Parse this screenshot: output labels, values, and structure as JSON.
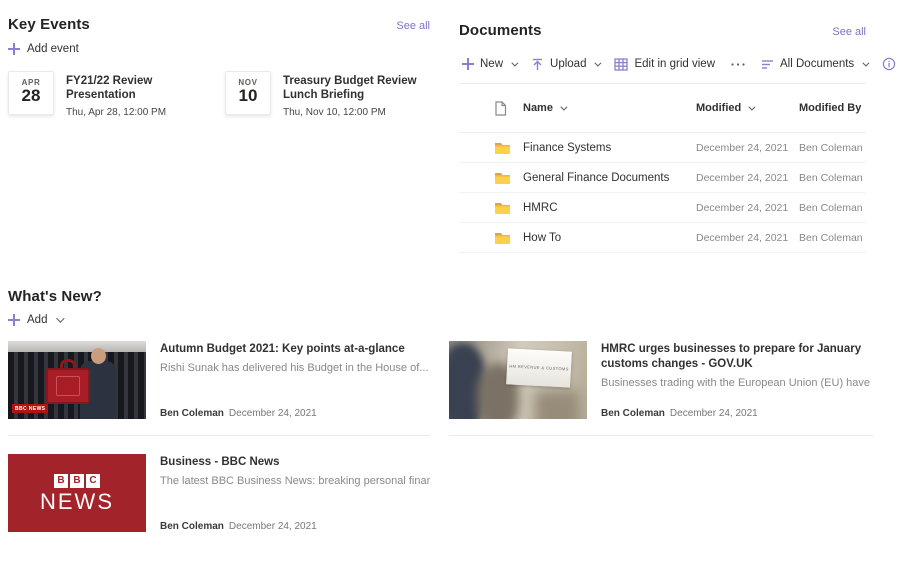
{
  "colors": {
    "accent": "#7b74c6",
    "icon_accent": "#8a7fd0",
    "folder_body": "#ffd04b",
    "folder_tab": "#e3a23e",
    "bbc_red": "#a3232b"
  },
  "key_events": {
    "title": "Key Events",
    "see_all": "See all",
    "add_label": "Add event",
    "events": [
      {
        "month": "APR",
        "day": "28",
        "title": "FY21/22 Review Presentation",
        "when": "Thu, Apr 28, 12:00 PM"
      },
      {
        "month": "NOV",
        "day": "10",
        "title": "Treasury Budget Review Lunch Briefing",
        "when": "Thu, Nov 10, 12:00 PM"
      }
    ]
  },
  "documents": {
    "title": "Documents",
    "see_all": "See all",
    "toolbar": {
      "new": "New",
      "upload": "Upload",
      "grid": "Edit in grid view",
      "view": "All Documents"
    },
    "columns": {
      "name": "Name",
      "modified": "Modified",
      "modified_by": "Modified By"
    },
    "rows": [
      {
        "name": "Finance Systems",
        "modified": "December 24, 2021",
        "modified_by": "Ben Coleman"
      },
      {
        "name": "General Finance Documents",
        "modified": "December 24, 2021",
        "modified_by": "Ben Coleman"
      },
      {
        "name": "HMRC",
        "modified": "December 24, 2021",
        "modified_by": "Ben Coleman"
      },
      {
        "name": "How To",
        "modified": "December 24, 2021",
        "modified_by": "Ben Coleman"
      }
    ]
  },
  "whats_new": {
    "title": "What's New?",
    "add_label": "Add",
    "cards": [
      {
        "title": "Autumn Budget 2021: Key points at-a-glance",
        "desc": "Rishi Sunak has delivered his Budget in the House of...",
        "author": "Ben Coleman",
        "date": "December 24, 2021",
        "image": "rishi-sunak-red-budget-box",
        "watermark": "BBC NEWS"
      },
      {
        "title": "HMRC urges businesses to prepare for January customs changes - GOV.UK",
        "desc": "Businesses trading with the European Union (EU) have less...",
        "author": "Ben Coleman",
        "date": "December 24, 2021",
        "image": "hmrc-building-blurred-people",
        "sign_text": "HM REVENUE & CUSTOMS"
      },
      {
        "title": "Business - BBC News",
        "desc": "The latest BBC Business News: breaking personal finance,...",
        "author": "Ben Coleman",
        "date": "December 24, 2021",
        "image": "bbc-news-logo",
        "bbc_letters": [
          "B",
          "B",
          "C"
        ],
        "bbc_word": "NEWS"
      }
    ]
  }
}
